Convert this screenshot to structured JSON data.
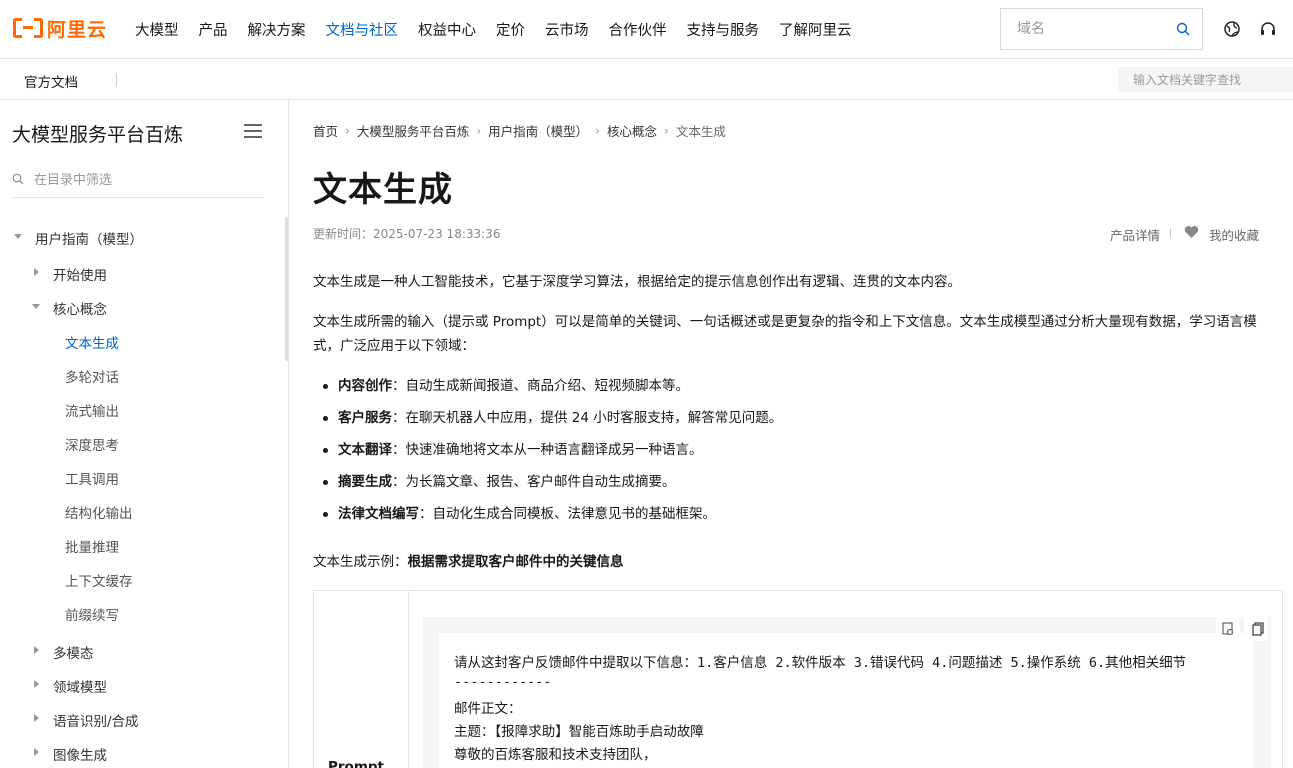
{
  "brand": {
    "name": "阿里云",
    "color": "#ff6a00"
  },
  "nav": {
    "items": [
      "大模型",
      "产品",
      "解决方案",
      "文档与社区",
      "权益中心",
      "定价",
      "云市场",
      "合作伙伴",
      "支持与服务",
      "了解阿里云"
    ],
    "active_index": 3,
    "active_color": "#0064c8"
  },
  "top_search": {
    "placeholder": "域名",
    "icon": "search-icon"
  },
  "top_icons": [
    "globe-icon",
    "headset-icon"
  ],
  "subbar": {
    "title": "官方文档",
    "search_placeholder": "输入文档关键字查找"
  },
  "sidebar": {
    "title": "大模型服务平台百炼",
    "filter_placeholder": "在目录中筛选",
    "tree": [
      {
        "label": "用户指南（模型）",
        "level": 0,
        "expanded": true
      },
      {
        "label": "开始使用",
        "level": 1,
        "expanded": false
      },
      {
        "label": "核心概念",
        "level": 1,
        "expanded": true
      },
      {
        "label": "文本生成",
        "level": 2,
        "active": true
      },
      {
        "label": "多轮对话",
        "level": 2
      },
      {
        "label": "流式输出",
        "level": 2
      },
      {
        "label": "深度思考",
        "level": 2
      },
      {
        "label": "工具调用",
        "level": 2
      },
      {
        "label": "结构化输出",
        "level": 2
      },
      {
        "label": "批量推理",
        "level": 2
      },
      {
        "label": "上下文缓存",
        "level": 2
      },
      {
        "label": "前缀续写",
        "level": 2
      },
      {
        "label": "多模态",
        "level": 1,
        "expanded": false
      },
      {
        "label": "领域模型",
        "level": 1,
        "expanded": false
      },
      {
        "label": "语音识别/合成",
        "level": 1,
        "expanded": false
      },
      {
        "label": "图像生成",
        "level": 1,
        "expanded": false
      }
    ]
  },
  "breadcrumb": [
    "首页",
    "大模型服务平台百炼",
    "用户指南（模型）",
    "核心概念",
    "文本生成"
  ],
  "article": {
    "title": "文本生成",
    "updated": "更新时间：2025-07-23 18:33:36",
    "product_detail": "产品详情",
    "favorite": "我的收藏",
    "intro": "文本生成是一种人工智能技术，它基于深度学习算法，根据给定的提示信息创作出有逻辑、连贯的文本内容。",
    "input_desc": "文本生成所需的输入（提示或 Prompt）可以是简单的关键词、一句话概述或是更复杂的指令和上下文信息。文本生成模型通过分析大量现有数据，学习语言模式，广泛应用于以下领域：",
    "bullets": [
      {
        "term": "内容创作",
        "desc": "：自动生成新闻报道、商品介绍、短视频脚本等。"
      },
      {
        "term": "客户服务",
        "desc": "：在聊天机器人中应用，提供 24 小时客服支持，解答常见问题。"
      },
      {
        "term": "文本翻译",
        "desc": "：快速准确地将文本从一种语言翻译成另一种语言。"
      },
      {
        "term": "摘要生成",
        "desc": "：为长篇文章、报告、客户邮件自动生成摘要。"
      },
      {
        "term": "法律文档编写",
        "desc": "：自动化生成合同模板、法律意见书的基础框架。"
      }
    ],
    "example_prefix": "文本生成示例：",
    "example_title": "根据需求提取客户邮件中的关键信息",
    "example_row_label": "Prompt",
    "code_lines": [
      "请从这封客户反馈邮件中提取以下信息：1.客户信息 2.软件版本 3.错误代码 4.问题描述 5.操作系统 6.其他相关细节",
      "------------",
      "邮件正文：",
      "主题：【报障求助】智能百炼助手启动故障",
      "尊敬的百炼客服和技术支持团队，"
    ]
  }
}
